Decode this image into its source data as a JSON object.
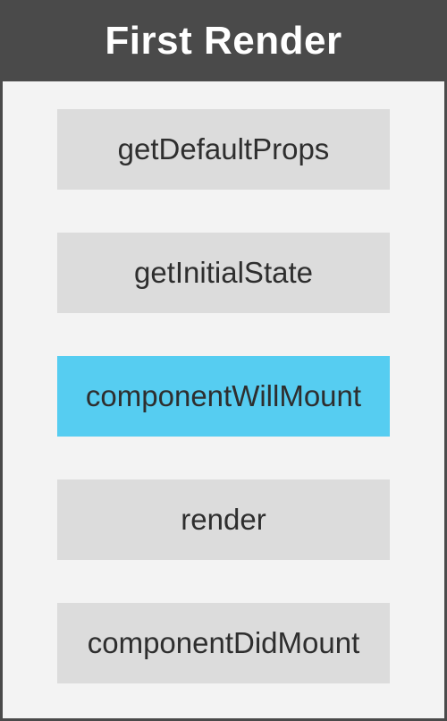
{
  "header": {
    "title": "First Render"
  },
  "steps": [
    {
      "label": "getDefaultProps",
      "active": false
    },
    {
      "label": "getInitialState",
      "active": false
    },
    {
      "label": "componentWillMount",
      "active": true
    },
    {
      "label": "render",
      "active": false
    },
    {
      "label": "componentDidMount",
      "active": false
    }
  ],
  "colors": {
    "header_bg": "#4a4a4a",
    "panel_bg": "#f3f3f3",
    "step_bg": "#dcdcdc",
    "active_step_bg": "#56cdf1",
    "text": "#2e2e2e"
  }
}
